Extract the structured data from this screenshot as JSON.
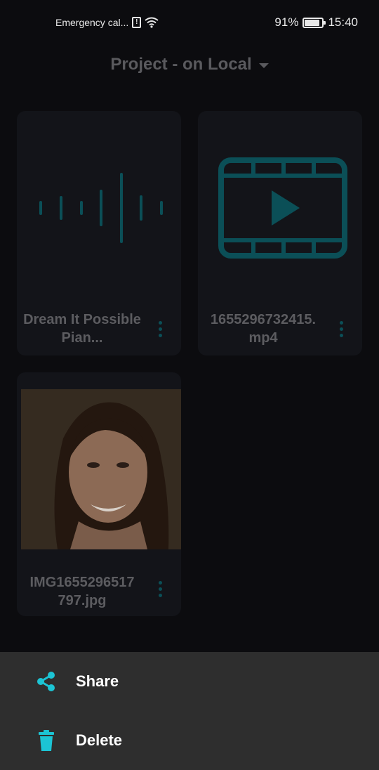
{
  "status_bar": {
    "carrier_text": "Emergency cal...",
    "battery": "91%",
    "time": "15:40",
    "icons": [
      "sim-alert-icon",
      "wifi-icon",
      "battery-icon"
    ]
  },
  "header": {
    "title": "Project - on Local",
    "dropdown_icon": "caret-down-icon"
  },
  "files": [
    {
      "name": "Dream It Possible Pian...",
      "type": "audio",
      "thumbnail_icon": "audio-waveform-icon",
      "menu_icon": "more-vert-icon"
    },
    {
      "name": "1655296732415.\nmp4",
      "type": "video",
      "thumbnail_icon": "video-film-icon",
      "menu_icon": "more-vert-icon"
    },
    {
      "name": "IMG1655296517\n797.jpg",
      "type": "image",
      "thumbnail": "portrait photo of smiling woman",
      "menu_icon": "more-vert-icon"
    }
  ],
  "bottom_sheet": {
    "items": [
      {
        "label": "Share",
        "icon": "share-icon"
      },
      {
        "label": "Delete",
        "icon": "trash-icon"
      }
    ]
  },
  "colors": {
    "background": "#0c0c0f",
    "card": "#131419",
    "accent_dim": "#0b4f57",
    "accent_bright": "#1cc4d4",
    "sheet": "#2e2e2e"
  }
}
